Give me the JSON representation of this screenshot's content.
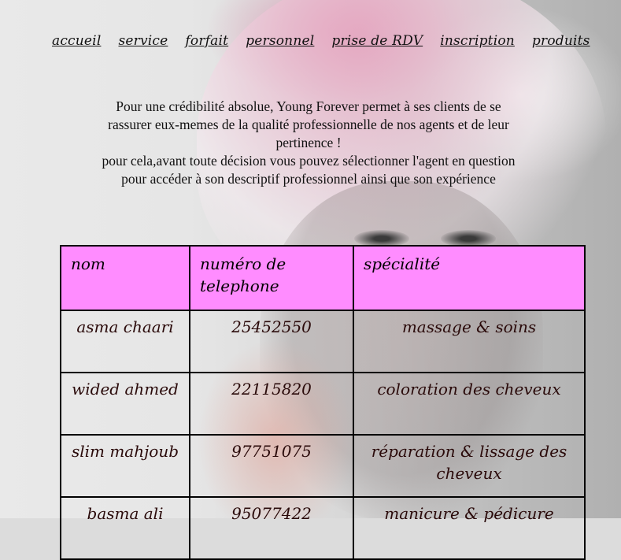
{
  "nav": {
    "items": [
      "accueil",
      "service",
      "forfait",
      "personnel",
      "prise de RDV",
      "inscription",
      "produits"
    ]
  },
  "intro": {
    "line1": "Pour une crédibilité absolue, Young Forever permet à ses clients de se rassurer eux-memes de la qualité professionnelle de nos agents et de leur pertinence !",
    "line2": "pour cela,avant toute décision vous pouvez sélectionner l'agent en question pour accéder à son descriptif professionnel ainsi que son expérience"
  },
  "table": {
    "headers": [
      "nom",
      "numéro de telephone",
      "spécialité"
    ],
    "rows": [
      {
        "nom": "asma chaari",
        "telephone": "25452550",
        "specialite": "massage & soins"
      },
      {
        "nom": "wided ahmed",
        "telephone": "22115820",
        "specialite": "coloration des cheveux"
      },
      {
        "nom": "slim mahjoub",
        "telephone": "97751075",
        "specialite": "réparation & lissage des cheveux"
      },
      {
        "nom": "basma ali",
        "telephone": "95077422",
        "specialite": "manicure & pédicure"
      }
    ]
  },
  "colors": {
    "header_bg": "#ff8cff",
    "text": "#111111"
  }
}
